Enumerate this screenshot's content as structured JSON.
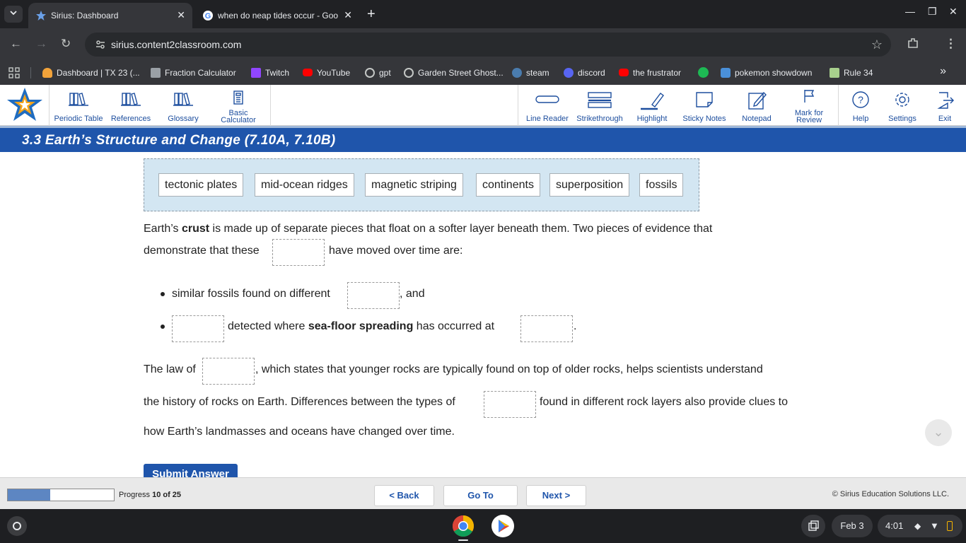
{
  "browser": {
    "tabs": [
      {
        "title": "Sirius: Dashboard",
        "active": true,
        "icon": "star-favicon"
      },
      {
        "title": "when do neap tides occur - Goo",
        "active": false,
        "icon": "google-favicon"
      }
    ],
    "url": "sirius.content2classroom.com",
    "bookmarks": [
      {
        "label": "Dashboard | TX 23 (...",
        "icon": "bulb-icon",
        "color": "#f2a33a"
      },
      {
        "label": "Fraction Calculator",
        "icon": "calculator-icon",
        "color": "#9aa0a6"
      },
      {
        "label": "Twitch",
        "icon": "twitch-icon",
        "color": "#9146ff"
      },
      {
        "label": "YouTube",
        "icon": "youtube-icon",
        "color": "#ff0000"
      },
      {
        "label": "gpt",
        "icon": "openai-icon",
        "color": "#c4c7c5"
      },
      {
        "label": "Garden Street Ghost...",
        "icon": "globe-icon",
        "color": "#c4c7c5"
      },
      {
        "label": "steam",
        "icon": "steam-icon",
        "color": "#4a7cae"
      },
      {
        "label": "discord",
        "icon": "discord-icon",
        "color": "#5865f2"
      },
      {
        "label": "the frustrator",
        "icon": "youtube-icon",
        "color": "#ff0000"
      },
      {
        "label": "",
        "icon": "spotify-icon",
        "color": "#1db954"
      },
      {
        "label": "pokemon showdown",
        "icon": "showdown-icon",
        "color": "#4a90d9"
      },
      {
        "label": "Rule 34",
        "icon": "rule34-icon",
        "color": "#a8d08d"
      }
    ]
  },
  "app": {
    "left_tools": [
      "Periodic Table",
      "References",
      "Glossary",
      "Basic Calculator"
    ],
    "right_tools": [
      "Line Reader",
      "Strikethrough",
      "Highlight",
      "Sticky Notes",
      "Notepad",
      "Mark for Review",
      "Help",
      "Settings",
      "Exit"
    ],
    "lesson_title": "3.3 Earth’s Structure and Change (7.10A, 7.10B)"
  },
  "question": {
    "word_bank": [
      "tectonic plates",
      "mid-ocean ridges",
      "magnetic striping",
      "continents",
      "superposition",
      "fossils"
    ],
    "p1_a": "Earth’s ",
    "p1_b": "crust",
    "p1_c": " is made up of separate pieces that float on a softer layer beneath them. Two pieces of evidence that",
    "p1_d": "demonstrate that these",
    "p1_e": "have moved over time are:",
    "b1_a": "similar fossils found on different",
    "b1_b": ", and",
    "b2_a": "detected where ",
    "b2_b": "sea-floor spreading",
    "b2_c": " has occurred at",
    "b2_d": ".",
    "p2_a": "The law of",
    "p2_b": ", which states that younger rocks are typically found on top of older rocks, helps scientists understand",
    "p2_c": "the history of rocks on Earth. Differences between the types of",
    "p2_d": "found in different rock layers also provide clues to",
    "p2_e": "how Earth’s landmasses and oceans have changed over time.",
    "submit_label": "Submit Answer"
  },
  "footer": {
    "progress_label": "Progress ",
    "progress_value": "10 of 25",
    "progress_fraction": 0.4,
    "back_label": "< Back",
    "goto_label": "Go To",
    "next_label": "Next >",
    "copyright": "© Sirius Education Solutions LLC."
  },
  "shelf": {
    "date": "Feb 3",
    "time": "4:01"
  },
  "colors": {
    "brand_blue": "#1f55ab",
    "word_bank_bg": "#d3e6f2",
    "progress_fill": "#5d86c2"
  }
}
